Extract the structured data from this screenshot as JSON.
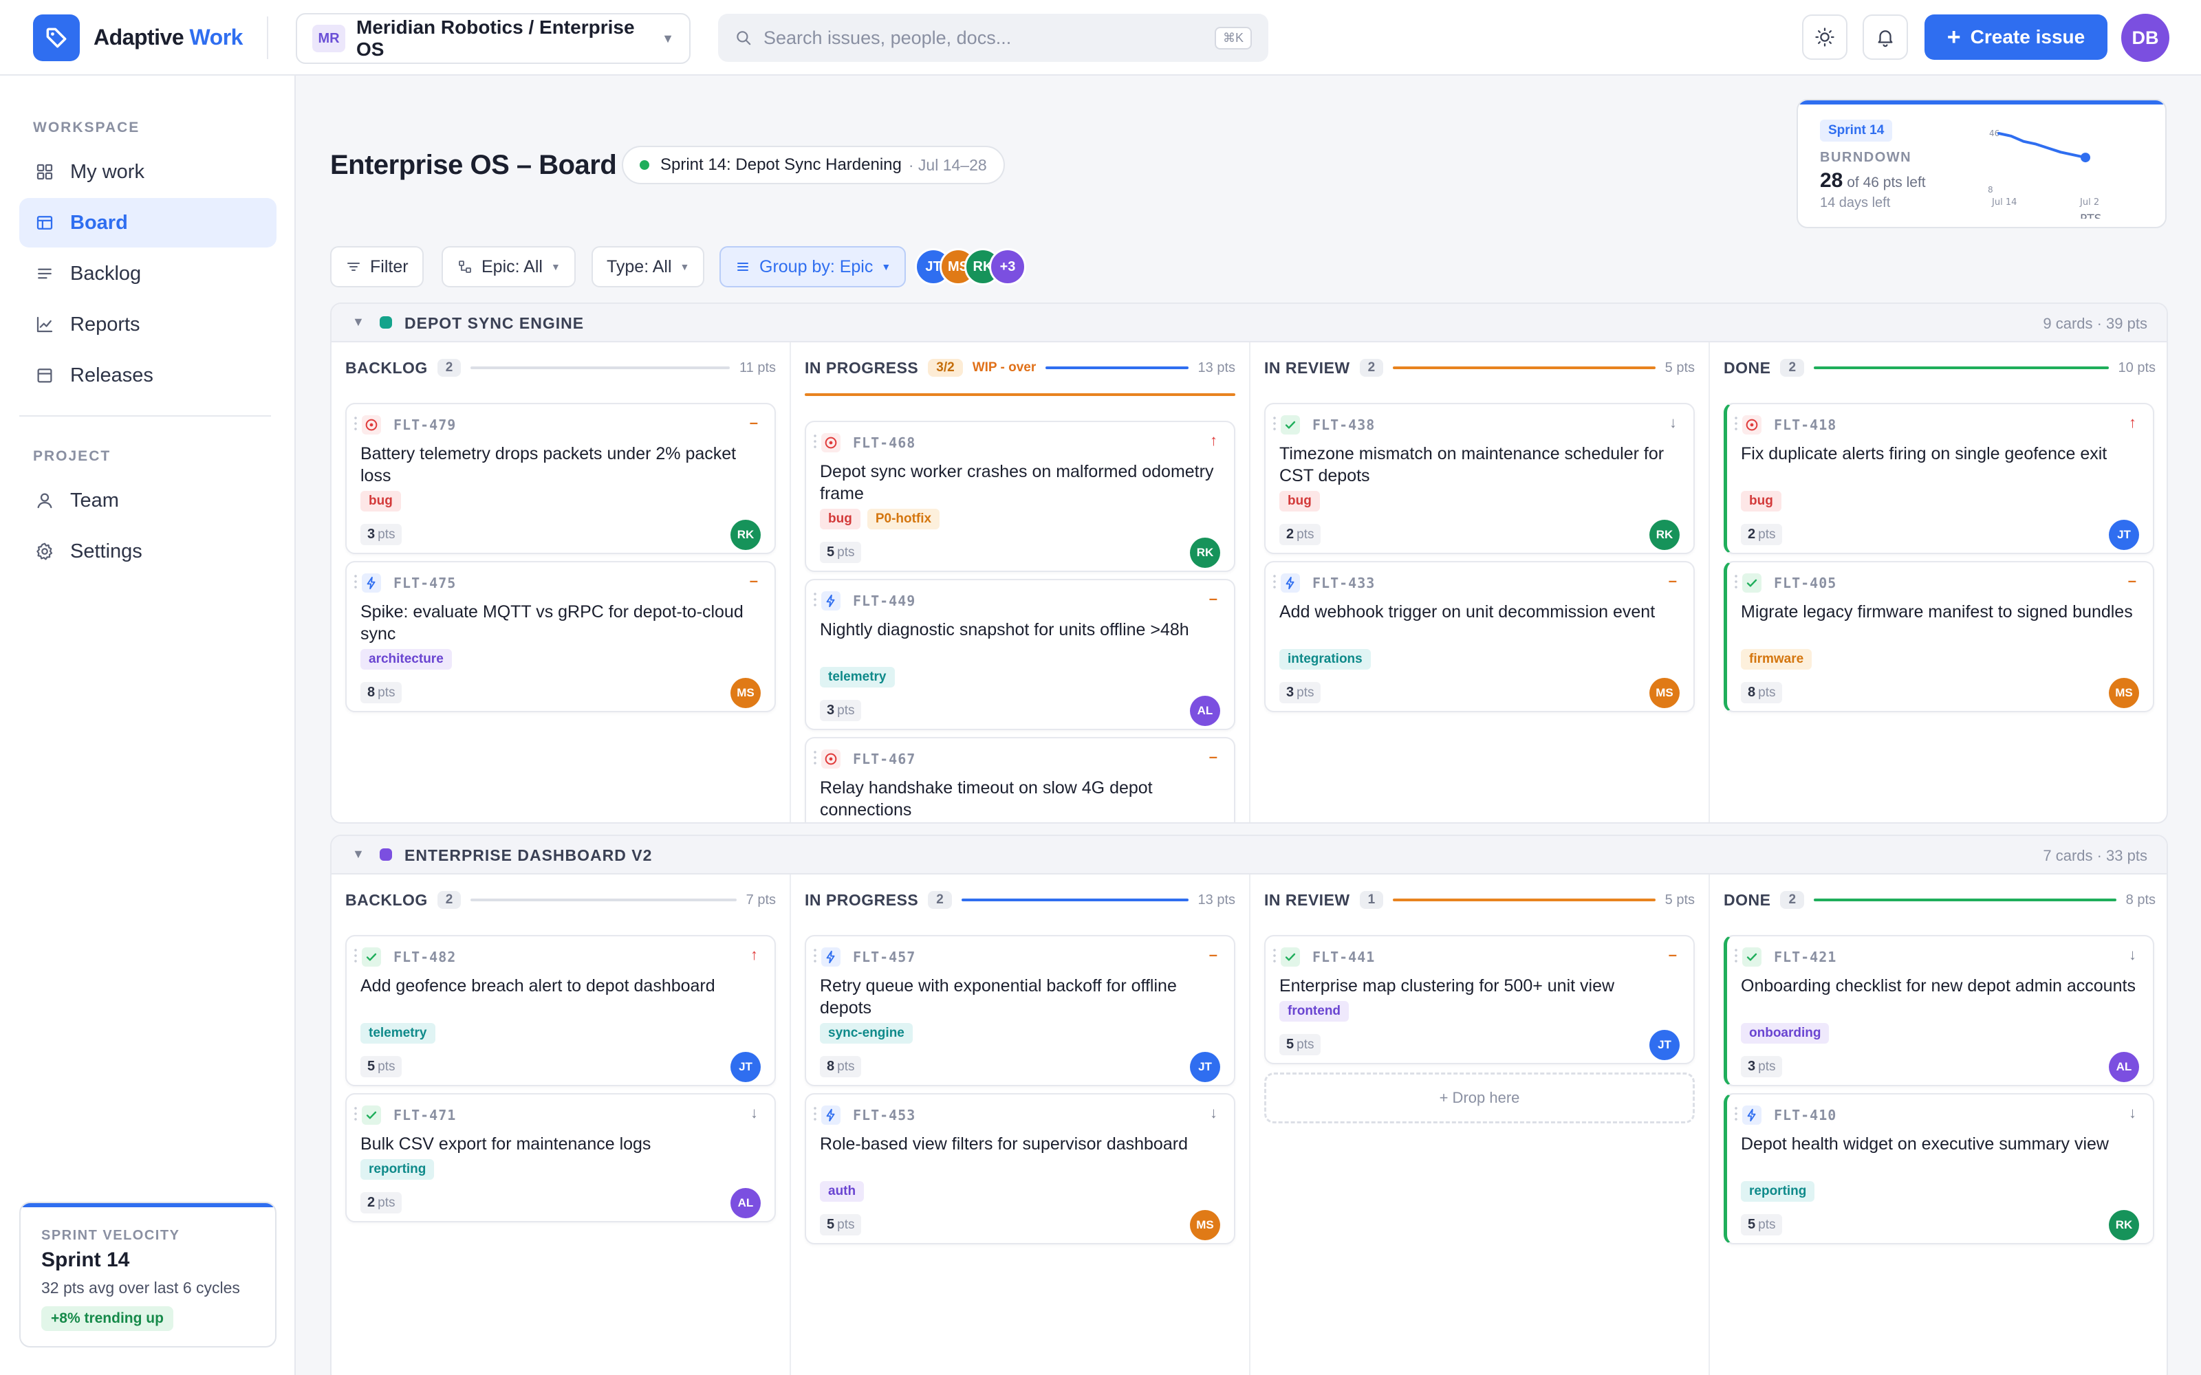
{
  "app": {
    "name_a": "Adaptive",
    "name_b": "Work"
  },
  "project": {
    "badge": "MR",
    "name": "Meridian Robotics / Enterprise OS"
  },
  "search": {
    "placeholder": "Search issues, people, docs...",
    "shortcut": "⌘K"
  },
  "header": {
    "create_label": "Create issue",
    "user_initials": "DB"
  },
  "sidebar": {
    "workspace_label": "WORKSPACE",
    "project_label": "PROJECT",
    "items": [
      {
        "label": "My work"
      },
      {
        "label": "Board"
      },
      {
        "label": "Backlog"
      },
      {
        "label": "Reports"
      },
      {
        "label": "Releases"
      },
      {
        "label": "Team"
      },
      {
        "label": "Settings"
      }
    ],
    "velocity": {
      "section": "SPRINT VELOCITY",
      "title": "Sprint 14",
      "subtitle": "32 pts avg over last 6 cycles",
      "trend": "+8% trending up"
    }
  },
  "page": {
    "title": "Enterprise OS – Board",
    "sprint_name": "Sprint 14: Depot Sync Hardening",
    "sprint_dates": "· Jul 14–28"
  },
  "burndown": {
    "tag": "Sprint 14",
    "section": "BURNDOWN",
    "remaining": "28",
    "of_text": "of 46 pts left",
    "days_left": "14 days left",
    "y_top": "46",
    "y_bottom": "8",
    "x_start": "Jul 14",
    "x_end": "Jul 2",
    "axis_label": "PTS",
    "chart_data": {
      "type": "line",
      "values": [
        46,
        44,
        40,
        38,
        35,
        32,
        30,
        28
      ],
      "ylim": [
        8,
        46
      ]
    }
  },
  "filters": {
    "filter": "Filter",
    "epic": "Epic: All",
    "type": "Type: All",
    "group": "Group by: Epic",
    "more_avatars": "+3",
    "avatars": [
      "JT",
      "MS",
      "RK"
    ]
  },
  "epics": [
    {
      "name": "DEPOT SYNC ENGINE",
      "color": "#14a38b",
      "meta": "9 cards  ·  39 pts",
      "columns": [
        {
          "title": "BACKLOG",
          "count": "2",
          "pts": "11 pts",
          "wip": "",
          "line": "#dcdfe6",
          "cards": [
            {
              "key": "FLT-479",
              "kind": "bug",
              "prio": "–",
              "title": "Battery telemetry drops packets under 2% packet loss",
              "tags": [
                {
                  "t": "bug",
                  "c": "bug"
                }
              ],
              "pts": "3",
              "av": "RK"
            },
            {
              "key": "FLT-475",
              "kind": "spike",
              "prio": "–",
              "title": "Spike: evaluate MQTT vs gRPC for depot-to-cloud sync",
              "tags": [
                {
                  "t": "architecture",
                  "c": "purple"
                }
              ],
              "pts": "8",
              "av": "MS"
            }
          ]
        },
        {
          "title": "IN PROGRESS",
          "count": "3/2",
          "pts": "13 pts",
          "wip": "WIP - over",
          "line": "#2f6ef0",
          "cards": [
            {
              "key": "FLT-468",
              "kind": "bug",
              "prio": "↑",
              "title": "Depot sync worker crashes on malformed odometry frame",
              "tags": [
                {
                  "t": "bug",
                  "c": "bug"
                },
                {
                  "t": "P0-hotfix",
                  "c": "orange"
                }
              ],
              "pts": "5",
              "av": "RK"
            },
            {
              "key": "FLT-449",
              "kind": "spike",
              "prio": "–",
              "title": "Nightly diagnostic snapshot for units offline >48h",
              "tags": [
                {
                  "t": "telemetry",
                  "c": "teal"
                }
              ],
              "pts": "3",
              "av": "AL"
            },
            {
              "key": "FLT-467",
              "kind": "bug",
              "prio": "–",
              "title": "Relay handshake timeout on slow 4G depot connections",
              "tags": [],
              "pts": "",
              "av": ""
            }
          ]
        },
        {
          "title": "IN REVIEW",
          "count": "2",
          "pts": "5 pts",
          "wip": "",
          "line": "#e8831f",
          "cards": [
            {
              "key": "FLT-438",
              "kind": "task",
              "prio": "↓",
              "title": "Timezone mismatch on maintenance scheduler for CST depots",
              "tags": [
                {
                  "t": "bug",
                  "c": "bug"
                }
              ],
              "pts": "2",
              "av": "RK"
            },
            {
              "key": "FLT-433",
              "kind": "spike",
              "prio": "–",
              "title": "Add webhook trigger on unit decommission event",
              "tags": [
                {
                  "t": "integrations",
                  "c": "teal"
                }
              ],
              "pts": "3",
              "av": "MS"
            }
          ]
        },
        {
          "title": "DONE",
          "count": "2",
          "pts": "10 pts",
          "wip": "",
          "line": "#1fae5b",
          "cards": [
            {
              "key": "FLT-418",
              "kind": "bug",
              "prio": "↑",
              "title": "Fix duplicate alerts firing on single geofence exit",
              "tags": [
                {
                  "t": "bug",
                  "c": "bug"
                }
              ],
              "pts": "2",
              "av": "JT"
            },
            {
              "key": "FLT-405",
              "kind": "task",
              "prio": "–",
              "title": "Migrate legacy firmware manifest to signed bundles",
              "tags": [
                {
                  "t": "firmware",
                  "c": "orange"
                }
              ],
              "pts": "8",
              "av": "MS"
            }
          ]
        }
      ]
    },
    {
      "name": "ENTERPRISE DASHBOARD V2",
      "color": "#7b4fe0",
      "meta": "7 cards  ·  33 pts",
      "columns": [
        {
          "title": "BACKLOG",
          "count": "2",
          "pts": "7 pts",
          "wip": "",
          "line": "#dcdfe6",
          "cards": [
            {
              "key": "FLT-482",
              "kind": "task",
              "prio": "↑",
              "title": "Add geofence breach alert to depot dashboard",
              "tags": [
                {
                  "t": "telemetry",
                  "c": "teal"
                }
              ],
              "pts": "5",
              "av": "JT"
            },
            {
              "key": "FLT-471",
              "kind": "task",
              "prio": "↓",
              "title": "Bulk CSV export for maintenance logs",
              "tags": [
                {
                  "t": "reporting",
                  "c": "teal"
                }
              ],
              "pts": "2",
              "av": "AL"
            }
          ]
        },
        {
          "title": "IN PROGRESS",
          "count": "2",
          "pts": "13 pts",
          "wip": "",
          "line": "#2f6ef0",
          "cards": [
            {
              "key": "FLT-457",
              "kind": "spike",
              "prio": "–",
              "title": "Retry queue with exponential backoff for offline depots",
              "tags": [
                {
                  "t": "sync-engine",
                  "c": "teal"
                }
              ],
              "pts": "8",
              "av": "JT"
            },
            {
              "key": "FLT-453",
              "kind": "spike",
              "prio": "↓",
              "title": "Role-based view filters for supervisor dashboard",
              "tags": [
                {
                  "t": "auth",
                  "c": "purple"
                }
              ],
              "pts": "5",
              "av": "MS"
            }
          ]
        },
        {
          "title": "IN REVIEW",
          "count": "1",
          "pts": "5 pts",
          "wip": "",
          "line": "#e8831f",
          "cards": [
            {
              "key": "FLT-441",
              "kind": "task",
              "prio": "–",
              "title": "Enterprise map clustering for 500+ unit view",
              "tags": [
                {
                  "t": "frontend",
                  "c": "purple"
                }
              ],
              "pts": "5",
              "av": "JT"
            }
          ],
          "drop": "+ Drop here"
        },
        {
          "title": "DONE",
          "count": "2",
          "pts": "8 pts",
          "wip": "",
          "line": "#1fae5b",
          "cards": [
            {
              "key": "FLT-421",
              "kind": "task",
              "prio": "↓",
              "title": "Onboarding checklist for new depot admin accounts",
              "tags": [
                {
                  "t": "onboarding",
                  "c": "purple"
                }
              ],
              "pts": "3",
              "av": "AL"
            },
            {
              "key": "FLT-410",
              "kind": "spike",
              "prio": "↓",
              "title": "Depot health widget on executive summary view",
              "tags": [
                {
                  "t": "reporting",
                  "c": "teal"
                }
              ],
              "pts": "5",
              "av": "RK"
            }
          ]
        }
      ]
    }
  ],
  "colors": {
    "accent": "#2f6ef0",
    "JT": "#2f6ef0",
    "MS": "#e07a16",
    "RK": "#16935a",
    "AL": "#7b4fe0",
    "more": "#7b4fe0"
  }
}
